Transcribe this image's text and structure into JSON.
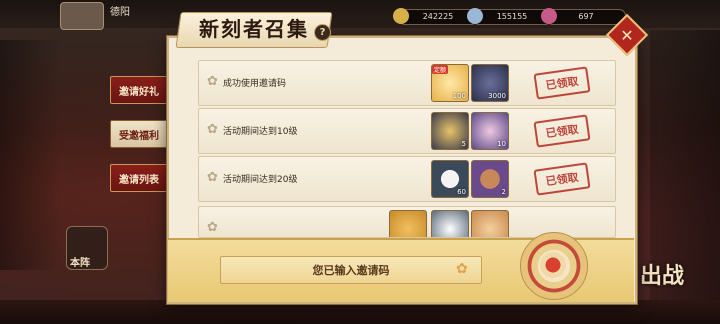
{
  "header": {
    "player_name": "德阳",
    "resources": [
      {
        "name": "currency-1",
        "value": "242225",
        "color": "#d8b04a"
      },
      {
        "name": "currency-2",
        "value": "155155",
        "color": "#9ab7d6"
      },
      {
        "name": "currency-3",
        "value": "697",
        "color": "#c85a8a"
      }
    ]
  },
  "side_tabs": [
    {
      "label": "邀请好礼",
      "active": false
    },
    {
      "label": "受邀福利",
      "active": true
    },
    {
      "label": "邀请列表",
      "active": false
    }
  ],
  "home_label": "本阵",
  "fight_label": "出战",
  "panel": {
    "title": "新刻者召集",
    "help": "?",
    "close": "✕"
  },
  "rows": [
    {
      "label": "成功使用邀请码",
      "items": [
        {
          "icon": "crystal-orb-icon",
          "qty": "100",
          "tag": "定额",
          "color": "#e8b04a"
        },
        {
          "icon": "tomoe-coin-icon",
          "qty": "3000",
          "tag": "",
          "color": "#2b2f4a"
        }
      ],
      "status": "已领取"
    },
    {
      "label": "活动期间达到10级",
      "items": [
        {
          "icon": "lantern-stand-icon",
          "qty": "5",
          "tag": "",
          "color": "#3a3a4a"
        },
        {
          "icon": "rainbow-orb-icon",
          "qty": "10",
          "tag": "",
          "color": "#5a4a8a"
        }
      ],
      "status": "已领取"
    },
    {
      "label": "活动期间达到20级",
      "items": [
        {
          "icon": "rice-ball-icon",
          "qty": "60",
          "tag": "",
          "color": "#3a4a5a"
        },
        {
          "icon": "pouch-bag-icon",
          "qty": "2",
          "tag": "",
          "color": "#6a4a8a"
        }
      ],
      "status": "已领取"
    }
  ],
  "input_bar": {
    "text": "您已输入邀请码"
  }
}
